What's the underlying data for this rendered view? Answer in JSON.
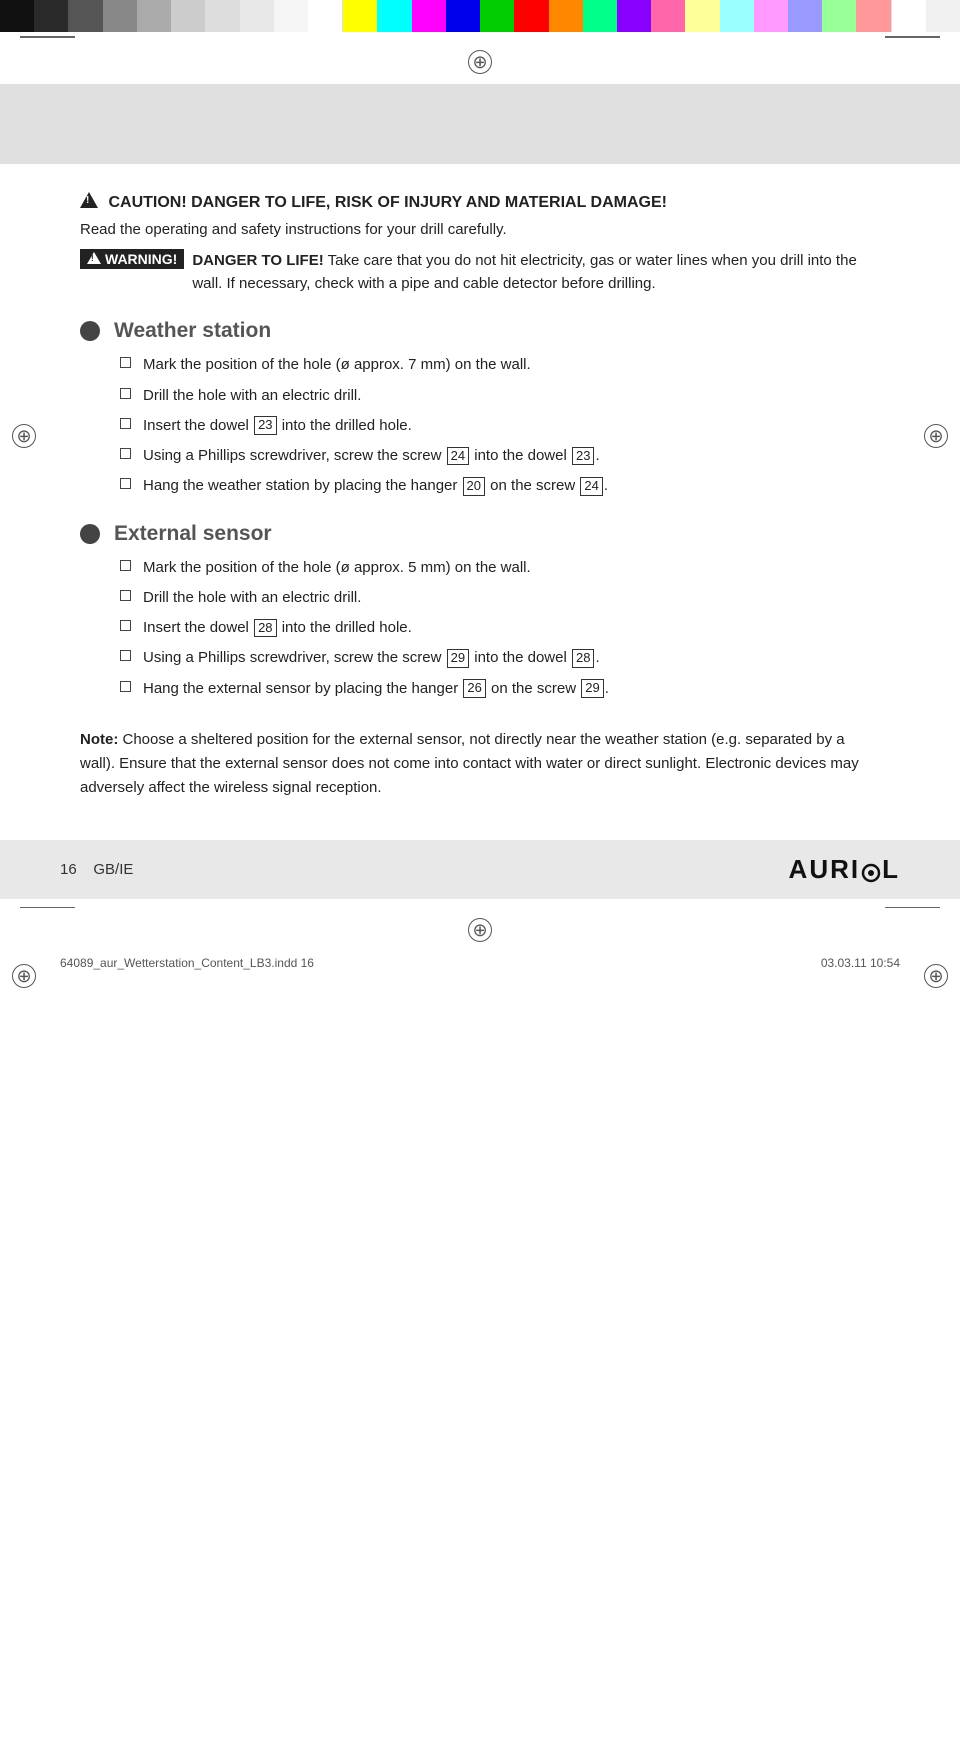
{
  "colorBar": {
    "swatches": [
      "#1a1a1a",
      "#3a3a3a",
      "#666",
      "#999",
      "#bbb",
      "#ddd",
      "#fff",
      "#f0f0f0",
      "#e0e0e0",
      "#c8c8c8",
      "#ffff00",
      "#00ffff",
      "#ff00ff",
      "#0000ff",
      "#00ff00",
      "#ff0000",
      "#ff8800",
      "#00ff88",
      "#8800ff",
      "#ff0088",
      "#ffff88",
      "#88ffff",
      "#ff88ff",
      "#8888ff",
      "#88ff88",
      "#ff8888",
      "#ffffff",
      "#eeeeee"
    ]
  },
  "caution": {
    "title": "CAUTION! DANGER TO LIFE, RISK OF INJURY AND MATERIAL DAMAGE!",
    "body": "Read the operating and safety instructions for your drill carefully.",
    "warningLabel": "WARNING!",
    "warningTitle": "DANGER TO LIFE!",
    "warningBody": "Take care that you do not hit electricity, gas or water lines when you drill into the wall. If necessary, check with a pipe and cable detector before drilling."
  },
  "weatherStation": {
    "title": "Weather station",
    "items": [
      "Mark the position of the hole (ø approx. 7 mm) on the wall.",
      "Drill the hole with an electric drill.",
      "Insert the dowel [23] into the drilled hole.",
      "Using a Phillips screwdriver, screw the screw [24] into the dowel [23].",
      "Hang the weather station by placing the hanger [20] on the screw [24]."
    ],
    "itemRefs": [
      [],
      [],
      [
        "23"
      ],
      [
        "24",
        "23"
      ],
      [
        "20",
        "24"
      ]
    ]
  },
  "externalSensor": {
    "title": "External sensor",
    "items": [
      "Mark the position of the hole (ø approx. 5 mm) on the wall.",
      "Drill the hole with an electric drill.",
      "Insert the dowel [28] into the drilled hole.",
      "Using a Phillips screwdriver, screw the screw [29] into the dowel [28].",
      "Hang the external sensor by placing the hanger [26] on the screw [29]."
    ]
  },
  "note": {
    "label": "Note:",
    "body": "Choose a sheltered position for the external sensor, not directly near the weather station (e.g. separated by a wall). Ensure that the external sensor does not come into contact with water or direct sunlight. Electronic devices may adversely affect the wireless signal reception."
  },
  "footer": {
    "page": "16",
    "region": "GB/IE",
    "logo": "AURIOL"
  },
  "bottomBar": {
    "left": "64089_aur_Wetterstation_Content_LB3.indd  16",
    "right": "03.03.11  10:54"
  }
}
